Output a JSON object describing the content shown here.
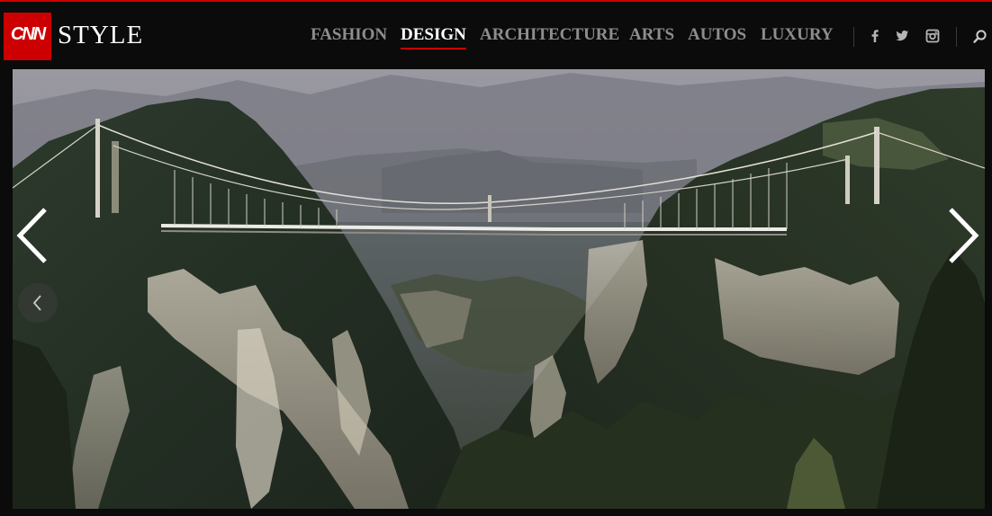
{
  "brand": {
    "logo_text": "CNN",
    "section_word": "STYLE"
  },
  "nav": {
    "items": [
      {
        "label": "FASHION",
        "active": false
      },
      {
        "label": "DESIGN",
        "active": true
      },
      {
        "label": "ARCHITECTURE",
        "active": false
      },
      {
        "label": "ARTS",
        "active": false
      },
      {
        "label": "AUTOS",
        "active": false
      },
      {
        "label": "LUXURY",
        "active": false
      }
    ]
  },
  "social": [
    "facebook-icon",
    "twitter-icon",
    "instagram-icon"
  ],
  "search": {
    "icon": "search-icon"
  },
  "gallery": {
    "image": "glass-bridge-canyon-photo",
    "controls": [
      "chevron-left-icon",
      "chevron-right-icon",
      "small-prev-icon"
    ]
  },
  "colors": {
    "accent": "#cc0000",
    "nav_inactive": "#8d8d8d",
    "nav_active": "#ffffff",
    "background": "#0b0b0b"
  }
}
